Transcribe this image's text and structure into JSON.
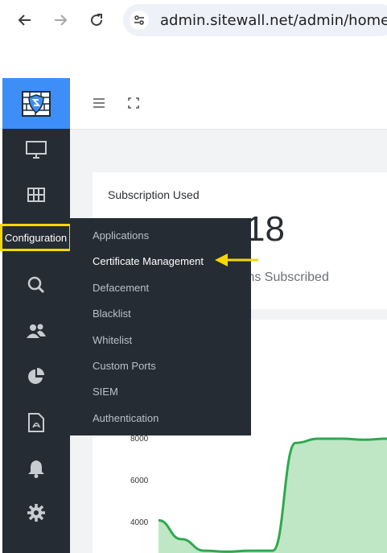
{
  "browser": {
    "url": "admin.sitewall.net/admin/home"
  },
  "sidebar": {
    "items": [
      {
        "icon": "monitor-icon"
      },
      {
        "icon": "grid-icon"
      },
      {
        "label": "Configuration"
      },
      {
        "icon": "search-icon"
      },
      {
        "icon": "users-icon"
      },
      {
        "icon": "pie-chart-icon"
      },
      {
        "icon": "pdf-icon"
      },
      {
        "icon": "bell-icon"
      },
      {
        "icon": "gear-icon"
      }
    ]
  },
  "flyout": {
    "items": [
      "Applications",
      "Certificate Management",
      "Defacement",
      "Blacklist",
      "Whitelist",
      "Custom Ports",
      "SIEM",
      "Authentication"
    ]
  },
  "subscription": {
    "title": "Subscription Used",
    "value": "18",
    "subtitle": "ions Subscribed"
  },
  "chart": {
    "y_ticks": [
      "8000",
      "6000",
      "4000"
    ]
  },
  "chart_data": {
    "type": "area",
    "series": [
      {
        "values": [
          4100,
          3200,
          2650,
          2600,
          2650,
          2650,
          7800,
          8000,
          8000,
          7950,
          8000
        ]
      }
    ],
    "ylim": [
      2600,
      8500
    ]
  },
  "colors": {
    "sidebar_bg": "#262c33",
    "logo_bg": "#3d8ef7",
    "highlight": "#f5d800",
    "chart_line": "#2fa84f",
    "chart_fill": "#bfe7c6"
  }
}
